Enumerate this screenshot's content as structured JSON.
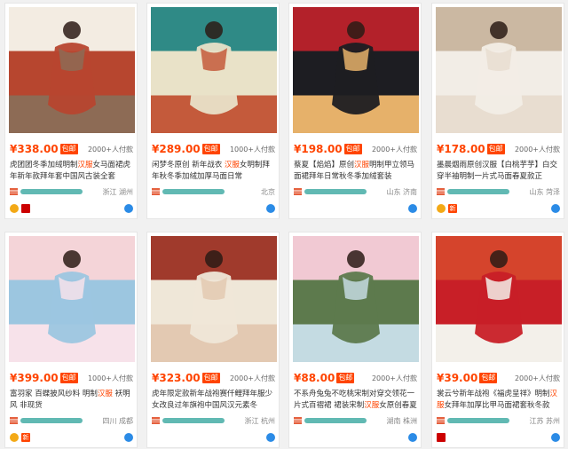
{
  "products": [
    {
      "price": "¥338.00",
      "badge": "包邮",
      "sales": "2000+人付款",
      "title_a": "虎团团冬季加绒明制",
      "title_hl": "汉服",
      "title_b": "女马面裙虎年新年款拜年套中国风古装全套",
      "location": "浙江 湖州",
      "icons": [
        "medal",
        "tag-red"
      ],
      "colors": [
        "#b7462f",
        "#f3ece2",
        "#8d6b55"
      ]
    },
    {
      "price": "¥289.00",
      "badge": "包邮",
      "sales": "1000+人付款",
      "title_a": "闲梦冬原创 新年战衣 ",
      "title_hl": "汉服",
      "title_b": "女明制拜年秋冬季加绒加厚马面日常",
      "location": "北京",
      "icons": [],
      "colors": [
        "#e9e2c8",
        "#2f8a86",
        "#c45a3b"
      ]
    },
    {
      "price": "¥198.00",
      "badge": "包邮",
      "sales": "2000+人付款",
      "title_a": "蔡夏【焰焰】原创",
      "title_hl": "汉服",
      "title_b": "明制甲立领马面裙拜年日常秋冬季加绒套装",
      "location": "山东 济南",
      "icons": [],
      "colors": [
        "#1d1d22",
        "#b3212a",
        "#e6b16a"
      ]
    },
    {
      "price": "¥178.00",
      "badge": "包邮",
      "sales": "2000+人付款",
      "title_a": "墨晨烟雨原创汉服【白桃芋芋】白交穿半袖明制一片式马面春夏款正",
      "title_hl": "",
      "title_b": "",
      "location": "山东 菏泽",
      "icons": [
        "medal",
        "new"
      ],
      "colors": [
        "#f2ede6",
        "#cbb8a2",
        "#e8ddd0"
      ]
    },
    {
      "price": "¥399.00",
      "badge": "包邮",
      "sales": "1000+人付款",
      "title_a": "富羽家 百蝶披风纱料 明制",
      "title_hl": "汉服",
      "title_b": " 袄明风 非现货",
      "location": "四川 成都",
      "icons": [
        "medal",
        "new"
      ],
      "colors": [
        "#9cc6e0",
        "#f4d4d8",
        "#f7e2ea"
      ]
    },
    {
      "price": "¥323.00",
      "badge": "包邮",
      "sales": "2000+人付款",
      "title_a": "虎年限定款新年战袍赛仟鲤拜年服少女改良过年旗袍中国风汉元素冬",
      "title_hl": "",
      "title_b": "",
      "location": "浙江 杭州",
      "icons": [],
      "colors": [
        "#efe7d8",
        "#a03a2c",
        "#e3c9b2"
      ]
    },
    {
      "price": "¥88.00",
      "badge": "包邮",
      "sales": "2000+人付款",
      "title_a": "不系舟兔兔不吃桃宋制对穿交领花一片式百褶裙 裙装宋制",
      "title_hl": "汉服",
      "title_b": "女原创春夏",
      "location": "湖南 株洲",
      "icons": [],
      "colors": [
        "#5d7a4d",
        "#f1c9d3",
        "#c4dbe2"
      ]
    },
    {
      "price": "¥39.00",
      "badge": "包邮",
      "sales": "2000+人付款",
      "title_a": "裳云兮新年战袍《福虎呈祥》明制",
      "title_hl": "汉服",
      "title_b": "女拜年加厚比甲马面裙套秋冬款",
      "location": "江苏 苏州",
      "icons": [
        "tag-red"
      ],
      "colors": [
        "#c81f27",
        "#d5442c",
        "#f3f0ea"
      ]
    }
  ]
}
